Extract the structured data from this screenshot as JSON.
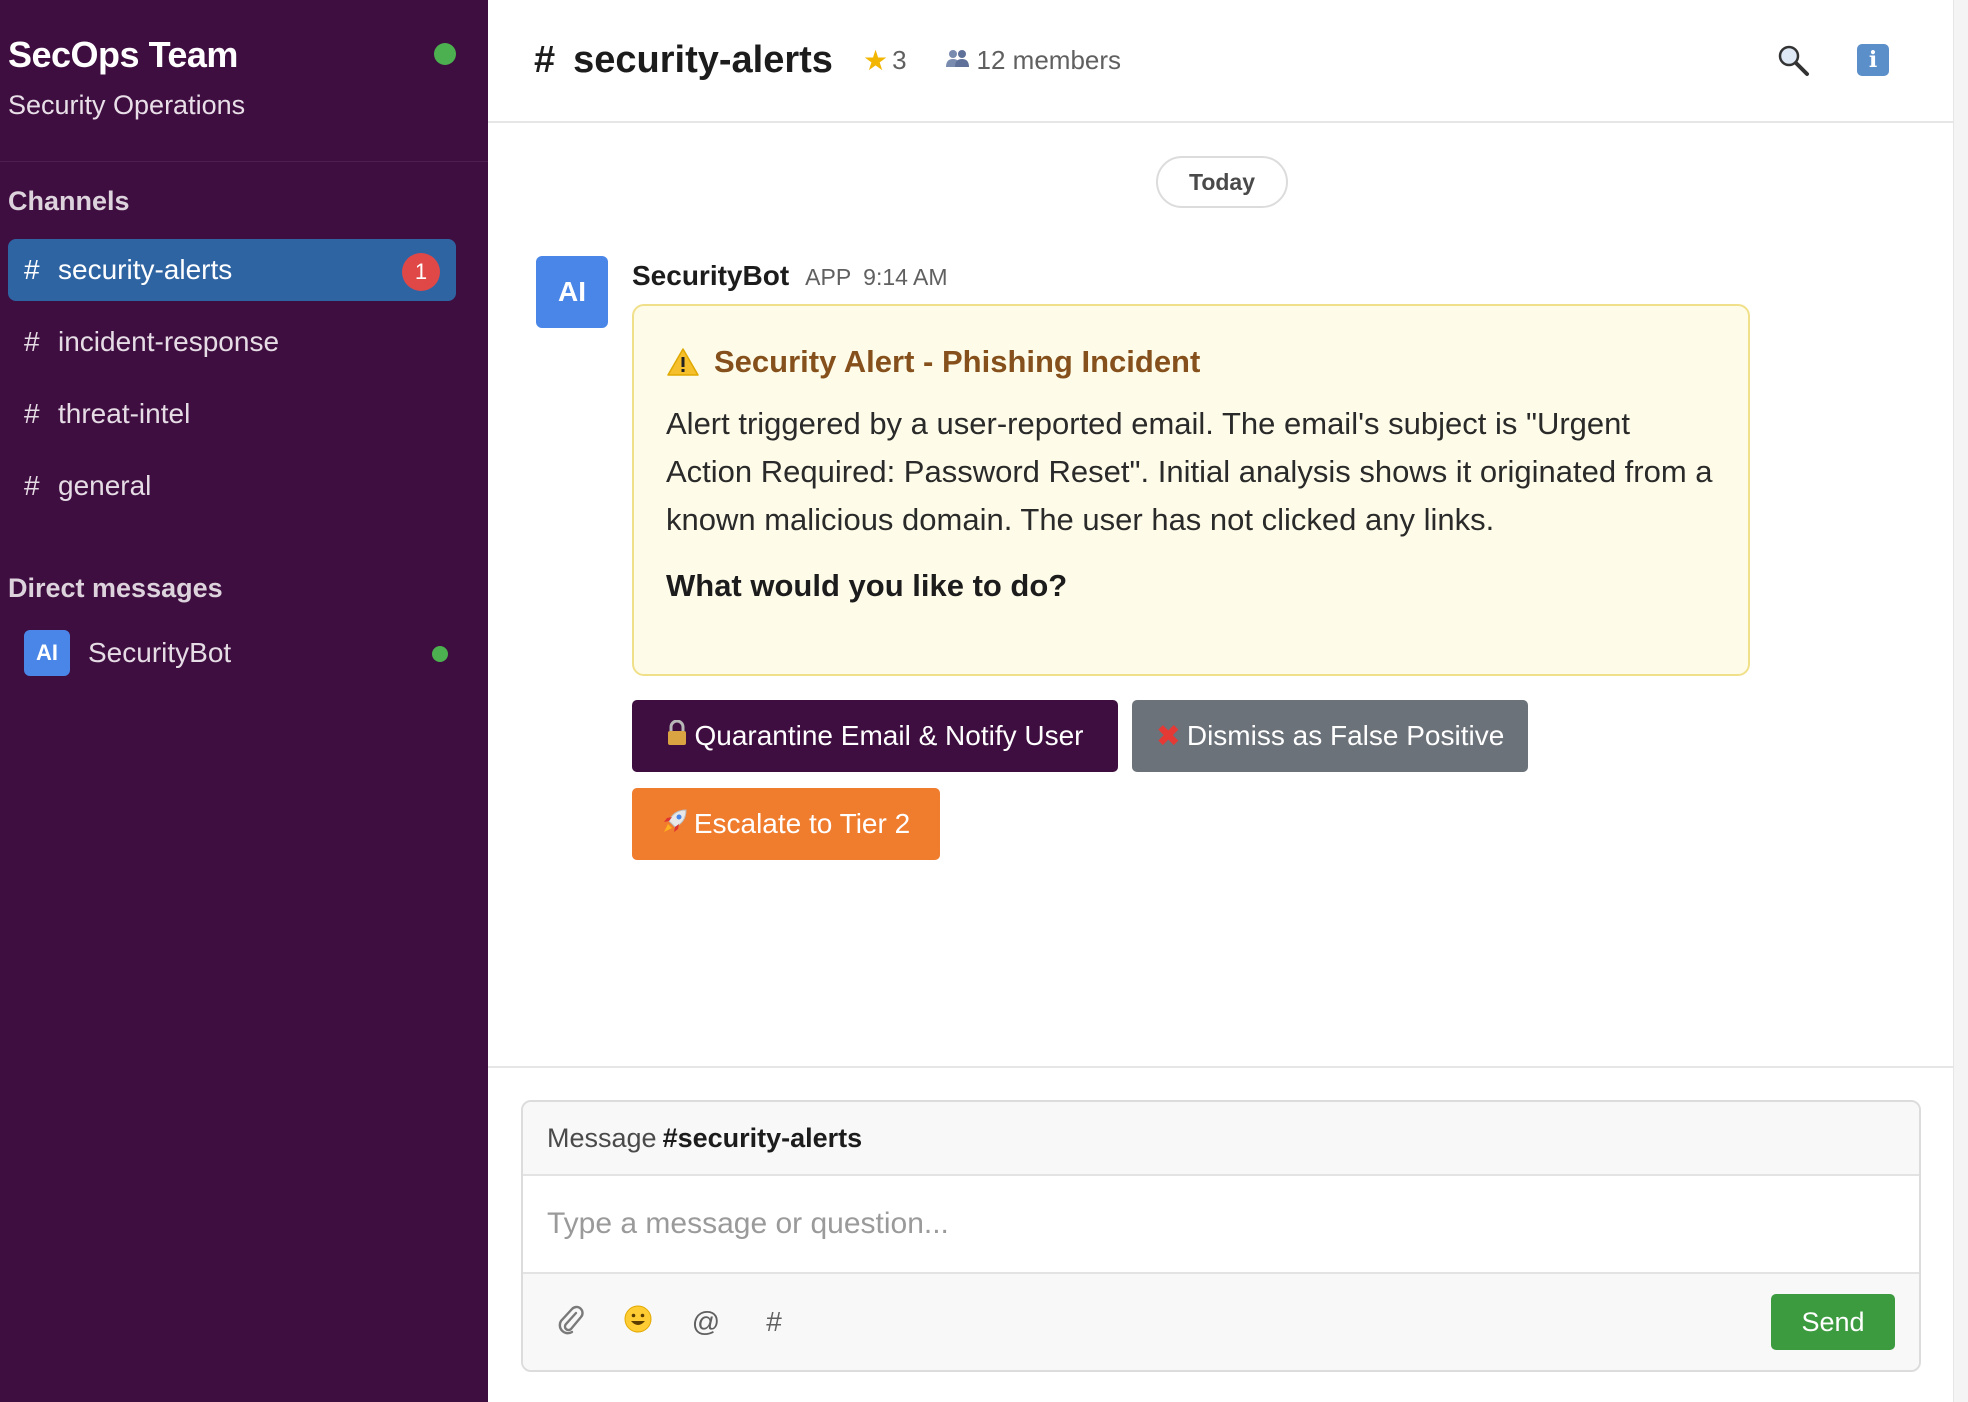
{
  "workspace": {
    "name": "SecOps Team",
    "subtitle": "Security Operations"
  },
  "sidebar": {
    "channels_title": "Channels",
    "channels": [
      {
        "label": "security-alerts",
        "badge": "1",
        "active": true
      },
      {
        "label": "incident-response"
      },
      {
        "label": "threat-intel"
      },
      {
        "label": "general"
      }
    ],
    "dm_title": "Direct messages",
    "dms": [
      {
        "avatar": "AI",
        "label": "SecurityBot",
        "online": true
      }
    ]
  },
  "header": {
    "hash": "#",
    "channel": "security-alerts",
    "stars": "3",
    "members": "12 members"
  },
  "timeline": {
    "date_divider": "Today"
  },
  "message": {
    "avatar": "AI",
    "sender": "SecurityBot",
    "app_tag": "APP",
    "time": "9:14 AM",
    "alert_title": "Security Alert - Phishing Incident",
    "alert_body": "Alert triggered by a user-reported email. The email's subject is \"Urgent Action Required: Password Reset\". Initial analysis shows it originated from a known malicious domain. The user has not clicked any links.",
    "alert_question": "What would you like to do?"
  },
  "actions": {
    "quarantine": "Quarantine Email & Notify User",
    "dismiss": "Dismiss as False Positive",
    "escalate": "Escalate to Tier 2"
  },
  "composer": {
    "label": "Message",
    "channel": "#security-alerts",
    "placeholder": "Type a message or question...",
    "tools": [
      "attachment-icon",
      "emoji-icon",
      "mention-icon",
      "channel-icon"
    ],
    "send_label": "Send"
  },
  "colors": {
    "sidebar_bg": "#3f0e40",
    "active_channel": "#2f64a3",
    "alert_bg": "#fefce8",
    "alert_title": "#85501c",
    "primary_btn": "#3f0e40",
    "secondary_btn": "#6c727a",
    "escalate_btn": "#f07c2e",
    "send_btn": "#3c9a3f",
    "online": "#4caf50",
    "badge": "#e04848"
  }
}
